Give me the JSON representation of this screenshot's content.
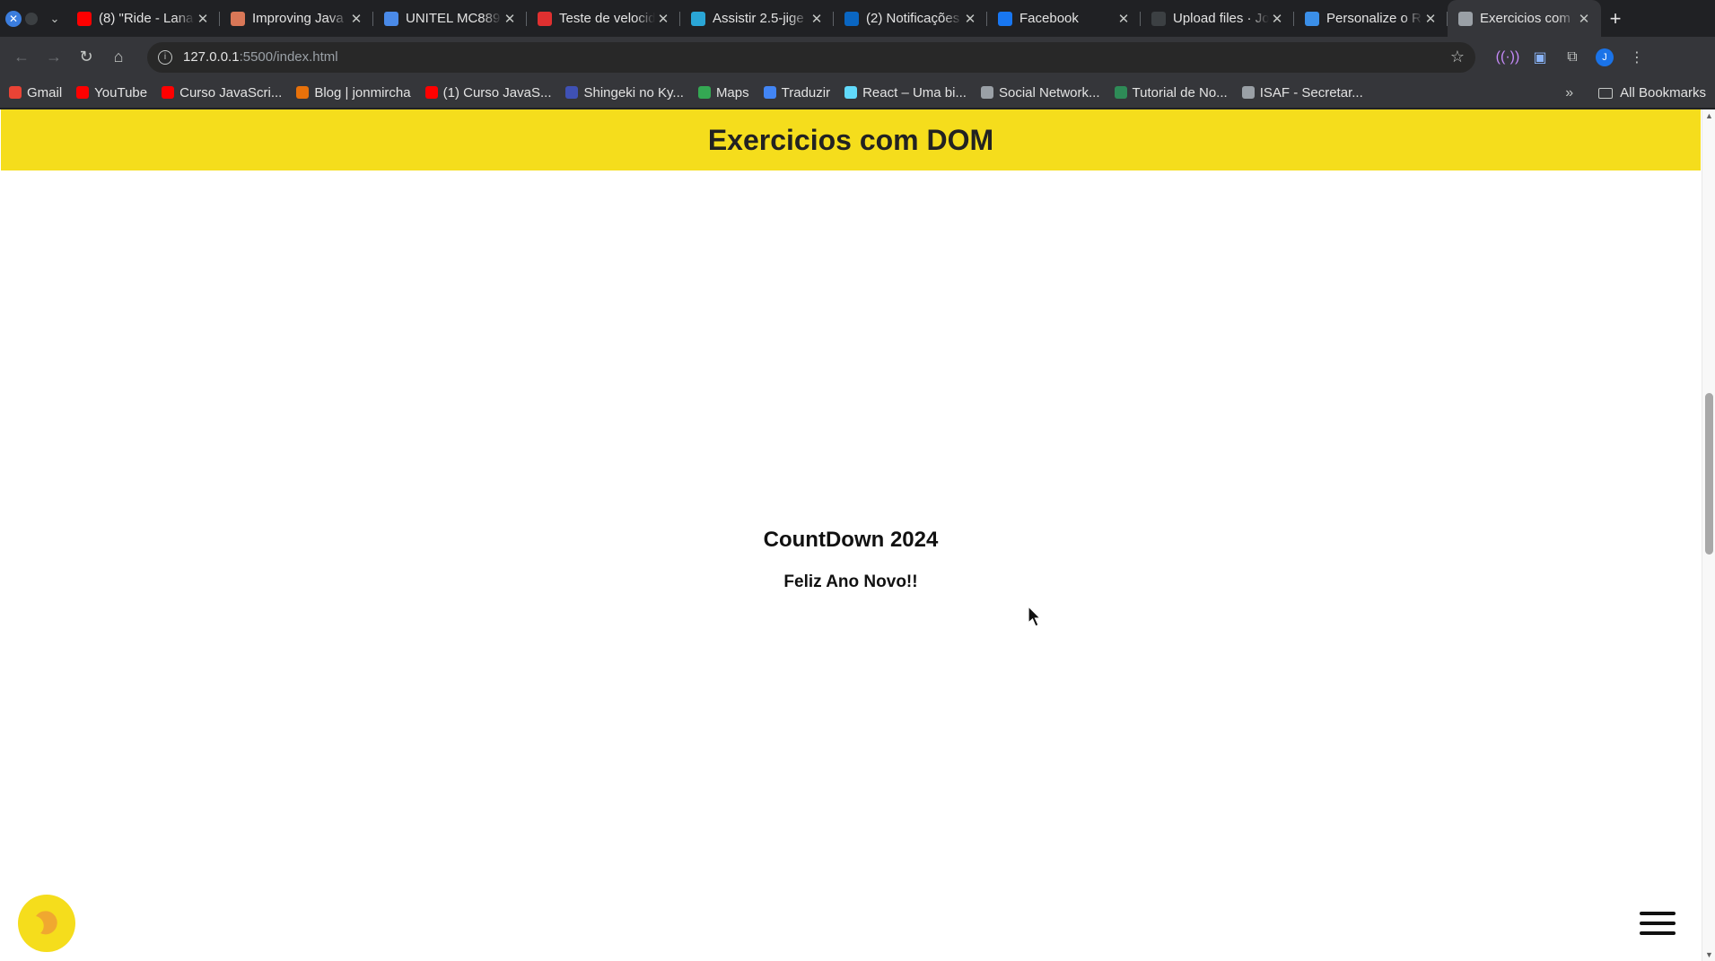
{
  "tabs": [
    {
      "title": "(8) \"Ride - Lana",
      "favicon": "youtube-icon",
      "color": "#ff0000"
    },
    {
      "title": "Improving Java",
      "favicon": "claude-icon",
      "color": "#d97757"
    },
    {
      "title": "UNITEL MC889",
      "favicon": "router-icon",
      "color": "#4a8ae8"
    },
    {
      "title": "Teste de velocid",
      "favicon": "speedtest-icon",
      "color": "#e03030"
    },
    {
      "title": "Assistir 2.5-jige",
      "favicon": "anime-icon",
      "color": "#2aa6d6"
    },
    {
      "title": "(2) Notificações",
      "favicon": "linkedin-icon",
      "color": "#0a66c2"
    },
    {
      "title": "Facebook",
      "favicon": "facebook-icon",
      "color": "#1877f2"
    },
    {
      "title": "Upload files · Jo",
      "favicon": "github-icon",
      "color": "#3c4043"
    },
    {
      "title": "Personalize o R",
      "favicon": "edge-icon",
      "color": "#3b8fe8"
    },
    {
      "title": "Exercicios com",
      "favicon": "globe-icon",
      "color": "#9aa0a6"
    }
  ],
  "toolbar": {
    "url_host": "127.0.0.1",
    "url_path": ":5500/index.html",
    "avatar_letter": "J"
  },
  "bookmarks": [
    {
      "label": "Gmail",
      "icon": "gmail-icon",
      "color": "#ea4335"
    },
    {
      "label": "YouTube",
      "icon": "youtube-icon",
      "color": "#ff0000"
    },
    {
      "label": "Curso JavaScri...",
      "icon": "youtube-icon",
      "color": "#ff0000"
    },
    {
      "label": "Blog | jonmircha",
      "icon": "blog-icon",
      "color": "#e8710a"
    },
    {
      "label": "(1) Curso JavaS...",
      "icon": "youtube-icon",
      "color": "#ff0000"
    },
    {
      "label": "Shingeki no Ky...",
      "icon": "anime-icon",
      "color": "#3f51b5"
    },
    {
      "label": "Maps",
      "icon": "maps-icon",
      "color": "#34a853"
    },
    {
      "label": "Traduzir",
      "icon": "translate-icon",
      "color": "#4285f4"
    },
    {
      "label": "React – Uma bi...",
      "icon": "react-icon",
      "color": "#61dafb"
    },
    {
      "label": "Social Network...",
      "icon": "settings-icon",
      "color": "#9aa0a6"
    },
    {
      "label": "Tutorial de No...",
      "icon": "w-icon",
      "color": "#2e8b57"
    },
    {
      "label": "ISAF - Secretar...",
      "icon": "globe-icon",
      "color": "#9aa0a6"
    }
  ],
  "all_bookmarks_label": "All Bookmarks",
  "page": {
    "header_title": "Exercicios com DOM",
    "countdown_title": "CountDown 2024",
    "countdown_message": "Feliz Ano Novo!!"
  },
  "colors": {
    "header_bg": "#f5dd1c",
    "toggle_bg": "#f5dd1c"
  }
}
